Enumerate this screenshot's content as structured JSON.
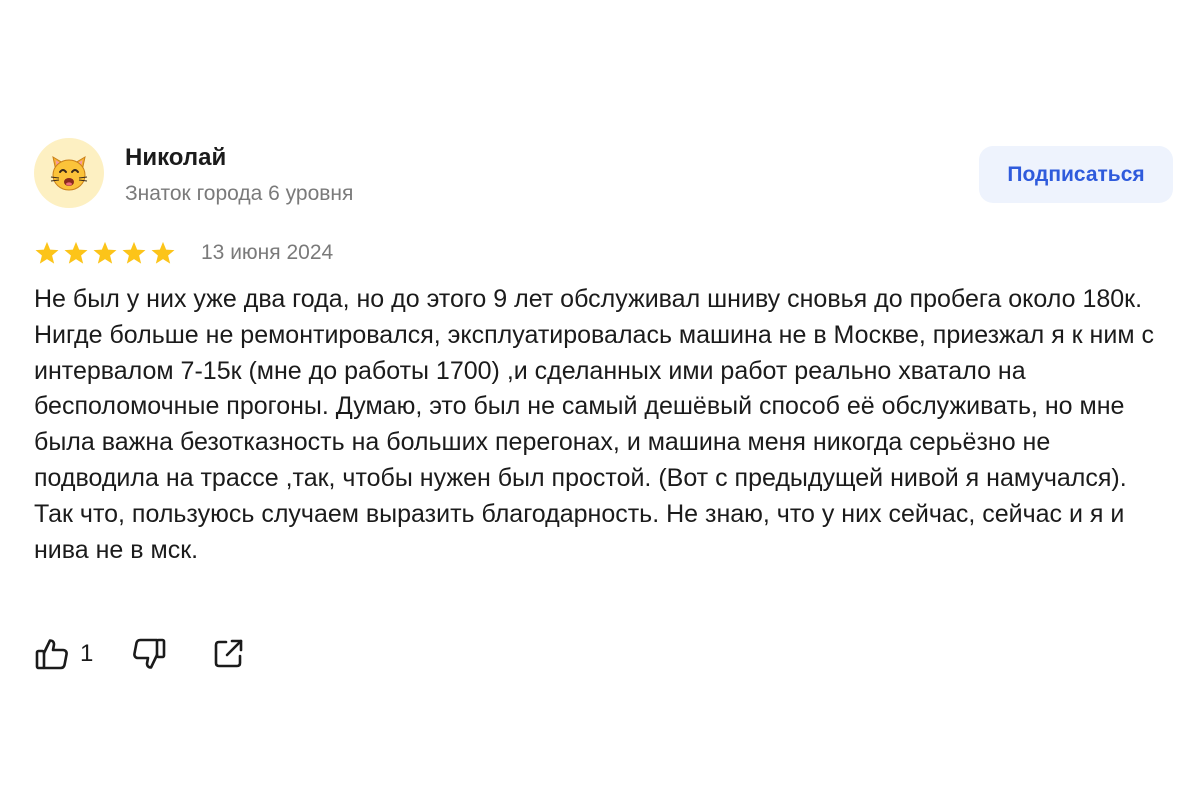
{
  "author": {
    "name": "Николай",
    "level": "Знаток города 6 уровня",
    "avatar_icon": "cat-face-emoji"
  },
  "subscribe_label": "Подписаться",
  "rating": {
    "stars": 5,
    "max": 5,
    "star_color": "#fcc419"
  },
  "date": "13 июня 2024",
  "review_text": "Не был у них уже два года, но до этого 9 лет обслуживал шниву сновья до пробега около 180к. Нигде больше не ремонтировался, эксплуатировалась машина не в Москве, приезжал я к ним с интервалом 7-15к (мне до работы 1700) ,и сделанных ими работ реально хватало на бесполомочные прогоны. Думаю, это был не самый дешёвый способ её обслуживать, но мне была важна безотказность на больших перегонах, и машина меня никогда серьёзно не подводила на трассе ,так, чтобы нужен был простой. (Вот с предыдущей нивой я намучался). Так что, пользуюсь случаем выразить благодарность. Не знаю, что у них сейчас, сейчас и я и нива не в мск.",
  "actions": {
    "like_count": "1",
    "like_icon": "thumbs-up-icon",
    "dislike_icon": "thumbs-down-icon",
    "share_icon": "share-icon"
  },
  "colors": {
    "accent": "#2f5bdc",
    "subscribe_bg": "#eef3fd",
    "secondary_text": "#7a7a7a"
  }
}
